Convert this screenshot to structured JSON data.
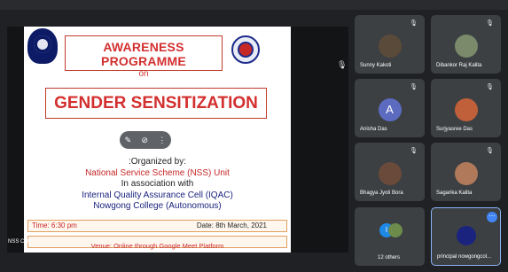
{
  "presentation": {
    "slide": {
      "heading_line1": "AWARENESS PROGRAMME",
      "heading_line2": "on",
      "main_title": "GENDER SENSITIZATION",
      "organized_by": ":Organized by:",
      "organizer": "National Service Scheme (NSS) Unit",
      "association": "In association with",
      "iqac": "Internal Quality Assurance Cell (IQAC)",
      "college": "Nowgong College (Autonomous)",
      "time": "Time: 6:30 pm",
      "date": "Date: 8th March, 2021",
      "venue": "Venue: Online through Google Meet Platform"
    },
    "presenter_label": "NSS Cell"
  },
  "participants": [
    {
      "name": "Sunny Kakoti",
      "avatar": "photo",
      "color": "#5a4a3a"
    },
    {
      "name": "Dibankor Raj Kalita",
      "avatar": "photo",
      "color": "#7a8a6a"
    },
    {
      "name": "Anisha Das",
      "avatar": "letter",
      "letter": "A",
      "color": "#5c6bc0"
    },
    {
      "name": "Surjyasree Das",
      "avatar": "photo",
      "color": "#c0603a"
    },
    {
      "name": "Bhagya Jyoti Bora",
      "avatar": "photo",
      "color": "#6a4a3a"
    },
    {
      "name": "Sagarika Kalita",
      "avatar": "photo",
      "color": "#b07a5a"
    },
    {
      "name": "12 others",
      "avatar": "group",
      "letter": "I"
    },
    {
      "name": "principal nowgongcol...",
      "avatar": "logo"
    }
  ],
  "colors": {
    "background": "#202124",
    "tile": "#3c4043",
    "accent": "#8ab4f8",
    "slide_red": "#d32f2f"
  }
}
